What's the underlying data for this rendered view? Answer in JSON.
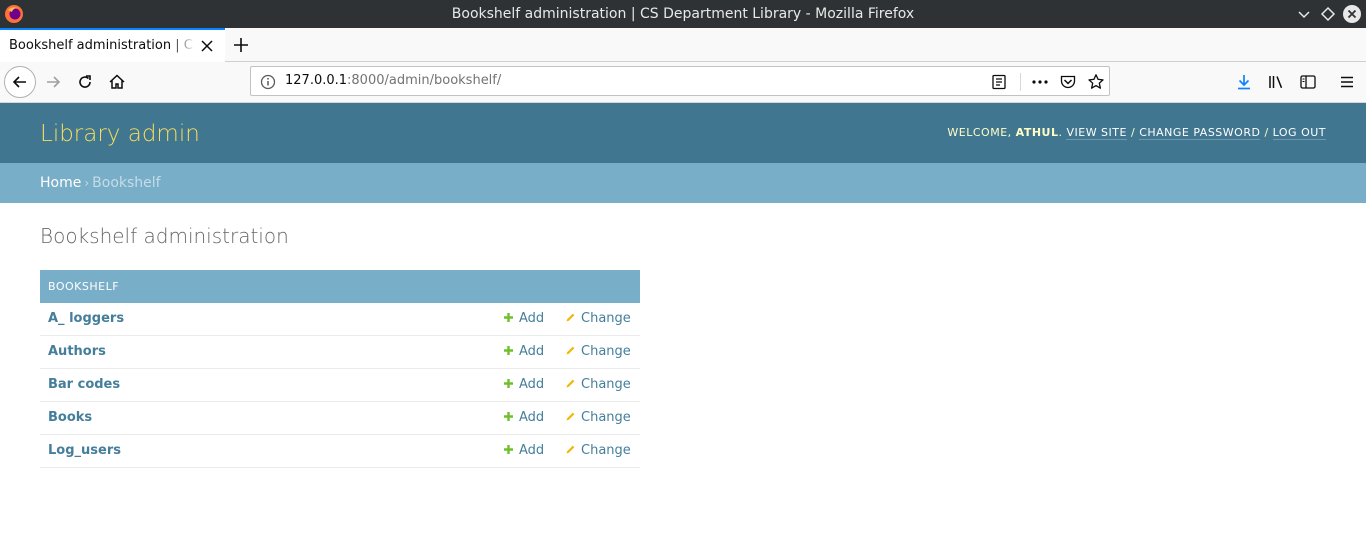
{
  "window": {
    "title": "Bookshelf administration | CS Department Library - Mozilla Firefox"
  },
  "tab": {
    "title": "Bookshelf administration | CS Department Library"
  },
  "urlbar": {
    "host": "127.0.0.1",
    "rest": ":8000/admin/bookshelf/"
  },
  "admin": {
    "branding": "Library admin",
    "welcome": "Welcome,",
    "username": "athul",
    "view_site": "View site",
    "change_password": "Change password",
    "log_out": "Log out",
    "separator": "/"
  },
  "breadcrumbs": {
    "home": "Home",
    "separator": "›",
    "current": "Bookshelf"
  },
  "content": {
    "page_title": "Bookshelf administration",
    "module_caption": "Bookshelf",
    "add_label": "Add",
    "change_label": "Change",
    "models": [
      {
        "name": "A_ loggers"
      },
      {
        "name": "Authors"
      },
      {
        "name": "Bar codes"
      },
      {
        "name": "Books"
      },
      {
        "name": "Log_users"
      }
    ]
  },
  "colors": {
    "header_bg": "#417690",
    "breadcrumb_bg": "#79aec8",
    "branding": "#f5dd5d",
    "link": "#447e9b",
    "add_icon": "#70bf2b",
    "change_icon": "#efb80b"
  }
}
